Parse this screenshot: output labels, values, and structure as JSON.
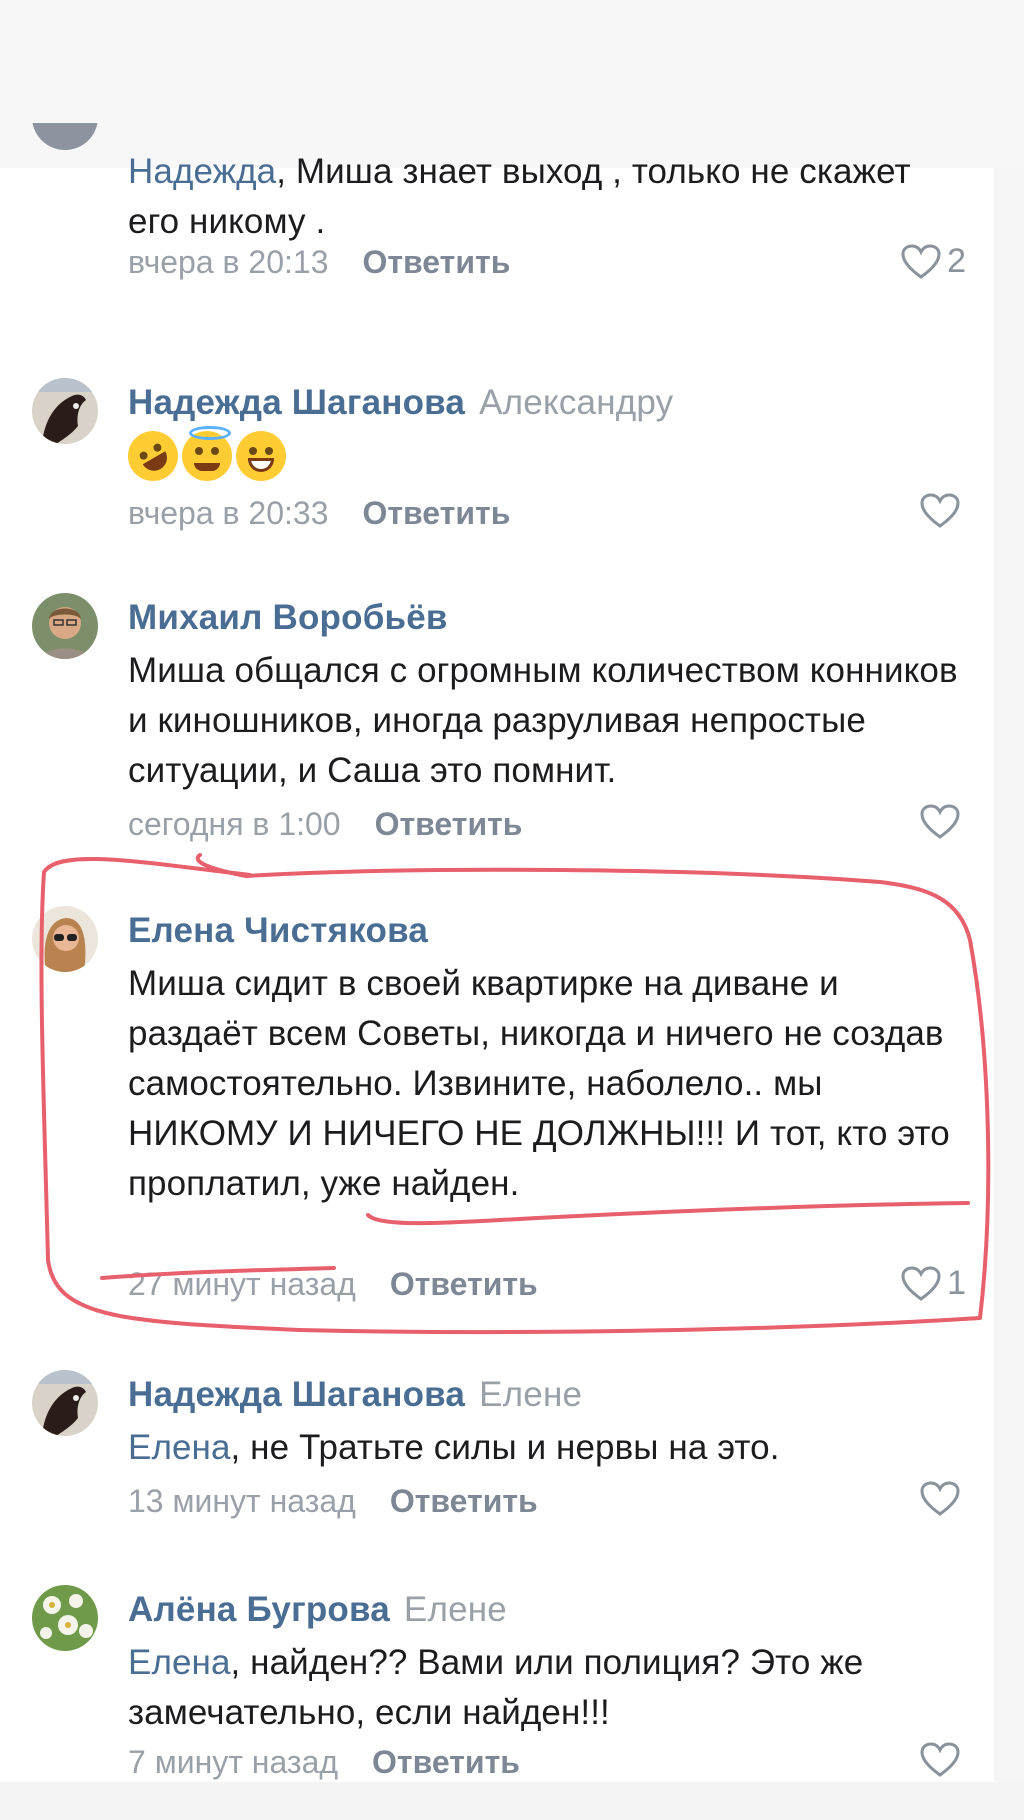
{
  "colors": {
    "author": "#4a6d93",
    "meta": "#9aa0a8",
    "reply_button": "#7d8795",
    "text": "#1c1c1e",
    "annotation": "#e8606c"
  },
  "comments": [
    {
      "author": "",
      "mention": "Надежда",
      "text": ", Миша знает выход , только не скажет его никому .",
      "time": "вчера в 20:13",
      "reply_label": "Ответить",
      "likes": "2"
    },
    {
      "author": "Надежда Шаганова",
      "reply_to": "Александру",
      "emojis": [
        "rolling-laughing-emoji",
        "halo-emoji",
        "grin-emoji"
      ],
      "time": "вчера в 20:33",
      "reply_label": "Ответить",
      "likes": ""
    },
    {
      "author": "Михаил Воробьёв",
      "text": "Миша общался с огромным количеством конников и киношников, иногда разруливая непростые ситуации, и Саша это помнит.",
      "time": "сегодня в 1:00",
      "reply_label": "Ответить",
      "likes": ""
    },
    {
      "author": "Елена Чистякова",
      "text": "Миша сидит в своей квартирке на диване и раздаёт всем Советы, никогда и ничего не создав самостоятельно. Извините, наболело.. мы НИКОМУ И НИЧЕГО НЕ ДОЛЖНЫ!!! И тот, кто это проплатил, уже найден.",
      "time": "27 минут назад",
      "reply_label": "Ответить",
      "likes": "1"
    },
    {
      "author": "Надежда Шаганова",
      "reply_to": "Елене",
      "mention": "Елена",
      "text": ", не Тратьте силы и нервы на это.",
      "time": "13 минут назад",
      "reply_label": "Ответить",
      "likes": ""
    },
    {
      "author": "Алёна Бугрова",
      "reply_to": "Елене",
      "mention": "Елена",
      "text": ", найден?? Вами или полиция? Это же замечательно, если найден!!!",
      "time": "7 минут назад",
      "reply_label": "Ответить",
      "likes": ""
    }
  ]
}
